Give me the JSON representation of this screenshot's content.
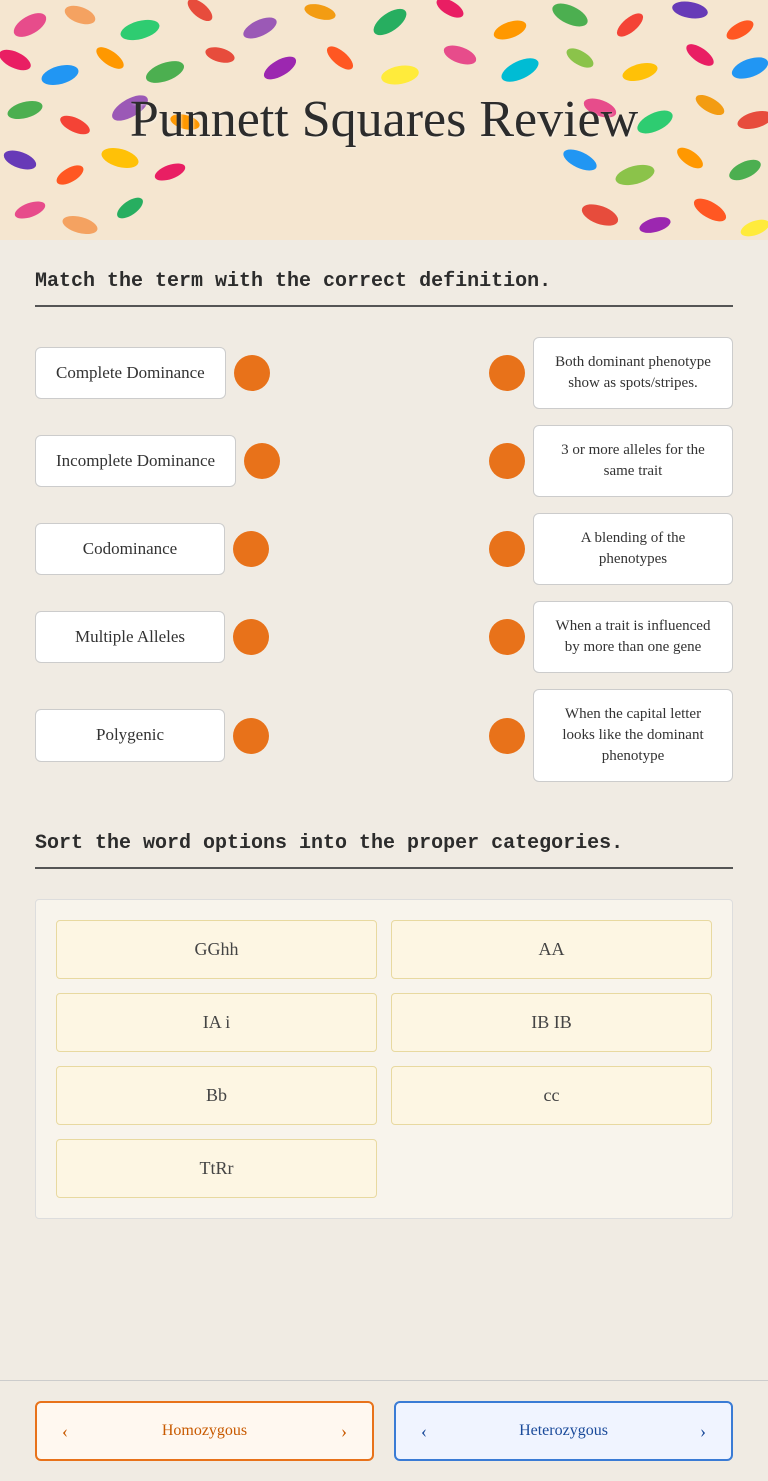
{
  "header": {
    "title": "Punnett Squares Review"
  },
  "match_section": {
    "instruction": "Match the term with the correct definition.",
    "terms": [
      {
        "id": "term1",
        "label": "Complete Dominance"
      },
      {
        "id": "term2",
        "label": "Incomplete Dominance"
      },
      {
        "id": "term3",
        "label": "Codominance"
      },
      {
        "id": "term4",
        "label": "Multiple Alleles"
      },
      {
        "id": "term5",
        "label": "Polygenic"
      }
    ],
    "definitions": [
      {
        "id": "def1",
        "label": "Both dominant phenotype show as spots/stripes."
      },
      {
        "id": "def2",
        "label": "3 or more alleles for the same trait"
      },
      {
        "id": "def3",
        "label": "A blending of the phenotypes"
      },
      {
        "id": "def4",
        "label": "When a trait is influenced by more than one gene"
      },
      {
        "id": "def5",
        "label": "When the capital letter looks like the dominant phenotype"
      }
    ]
  },
  "sort_section": {
    "instruction": "Sort the word options into the proper categories.",
    "items": [
      {
        "id": "s1",
        "label": "GGhh",
        "position": "left"
      },
      {
        "id": "s2",
        "label": "AA",
        "position": "right"
      },
      {
        "id": "s3",
        "label": "IA i",
        "position": "left"
      },
      {
        "id": "s4",
        "label": "IB IB",
        "position": "right"
      },
      {
        "id": "s5",
        "label": "Bb",
        "position": "left"
      },
      {
        "id": "s6",
        "label": "cc",
        "position": "right"
      },
      {
        "id": "s7",
        "label": "TtRr",
        "position": "left",
        "full_width": false
      }
    ]
  },
  "bottom_section": {
    "card_left": {
      "label": "Homozygous",
      "color": "orange",
      "arrow_left": "‹",
      "arrow_right": "›"
    },
    "card_right": {
      "label": "Heterozygous",
      "color": "blue",
      "arrow_left": "‹",
      "arrow_right": "›"
    }
  }
}
